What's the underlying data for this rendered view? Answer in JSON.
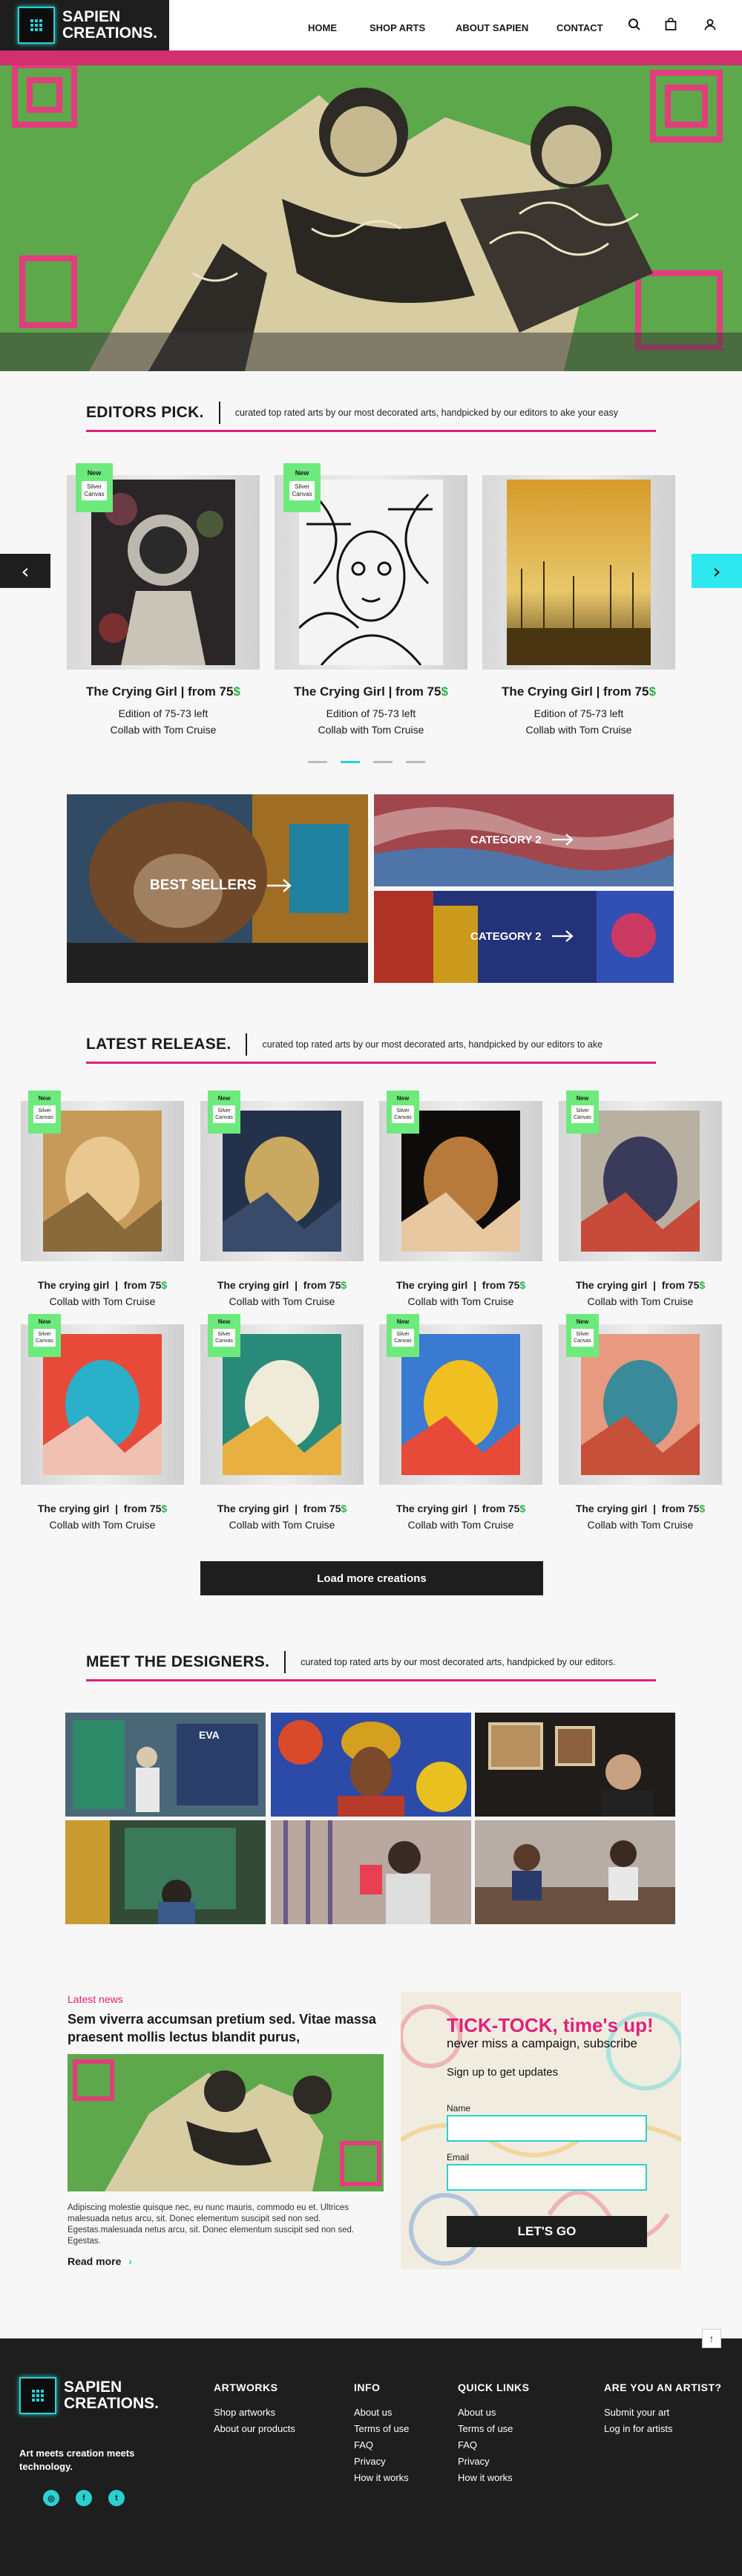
{
  "header": {
    "brand_line1": "SAPIEN",
    "brand_line2": "CREATIONS.",
    "nav": [
      "HOME",
      "SHOP ARTS",
      "ABOUT SAPIEN",
      "CONTACT"
    ],
    "icons": [
      "search-icon",
      "bag-icon",
      "user-icon"
    ]
  },
  "editors": {
    "title": "EDITORS PICK.",
    "subtitle": "curated top rated arts by our most decorated arts, handpicked by our editors to ake your easy",
    "prev_arrow": "‹",
    "next_arrow": "›",
    "cards": [
      {
        "tag": "New",
        "material": "Silver Canvas",
        "name": "The Crying Girl",
        "price_prefix": "from 75",
        "currency": "$",
        "edition": "Edition of 75-73 left",
        "collab": "Collab with Tom Cruise"
      },
      {
        "tag": "New",
        "material": "Silver Canvas",
        "name": "The Crying Girl",
        "price_prefix": "from 75",
        "currency": "$",
        "edition": "Edition of 75-73 left",
        "collab": "Collab with Tom Cruise"
      },
      {
        "tag": "",
        "material": "",
        "name": "The Crying Girl",
        "price_prefix": "from 75",
        "currency": "$",
        "edition": "Edition of 75-73 left",
        "collab": "Collab with Tom Cruise"
      }
    ],
    "active_dot": 1
  },
  "categories": {
    "best_sellers": "BEST  SELLERS",
    "cat_a": "CATEGORY 2",
    "cat_b": "CATEGORY 2"
  },
  "latest": {
    "title": "LATEST RELEASE.",
    "subtitle": "curated top rated arts by our most decorated arts, handpicked by our editors to ake",
    "tag": "New",
    "material": "Silver Canvas",
    "items": [
      {
        "name": "The crying girl",
        "price": "from 75",
        "currency": "$",
        "collab": "Collab with Tom Cruise"
      },
      {
        "name": "The crying girl",
        "price": "from 75",
        "currency": "$",
        "collab": "Collab with Tom Cruise"
      },
      {
        "name": "The crying girl",
        "price": "from 75",
        "currency": "$",
        "collab": "Collab with Tom Cruise"
      },
      {
        "name": "The crying girl",
        "price": "from 75",
        "currency": "$",
        "collab": "Collab with Tom Cruise"
      },
      {
        "name": "The crying girl",
        "price": "from 75",
        "currency": "$",
        "collab": "Collab with Tom Cruise"
      },
      {
        "name": "The crying girl",
        "price": "from 75",
        "currency": "$",
        "collab": "Collab with Tom Cruise"
      },
      {
        "name": "The crying girl",
        "price": "from 75",
        "currency": "$",
        "collab": "Collab with Tom Cruise"
      },
      {
        "name": "The crying girl",
        "price": "from 75",
        "currency": "$",
        "collab": "Collab with Tom Cruise"
      }
    ],
    "load_more": "Load more creations"
  },
  "designers": {
    "title": "MEET THE DESIGNERS.",
    "subtitle": "curated top rated arts by our most decorated arts, handpicked by our editors.",
    "gallery_label": "EVA"
  },
  "news": {
    "tag": "Latest news",
    "title": "Sem viverra accumsan pretium sed. Vitae massa praesent mollis lectus blandit purus,",
    "body": "Adipiscing molestie quisque nec, eu nunc mauris, commodo eu et. Ultrices malesuada netus arcu, sit. Donec elementum suscipit sed non sed. Egestas.malesuada netus arcu, sit. Donec elementum suscipit sed non sed. Egestas.",
    "read_more": "Read more"
  },
  "subscribe": {
    "headline": "TICK-TOCK, time's up!",
    "tagline": "never miss a campaign, subscribe",
    "signup": "Sign up to get updates",
    "name_label": "Name",
    "email_label": "Email",
    "button": "LET'S GO"
  },
  "footer": {
    "brand_line1": "SAPIEN",
    "brand_line2": "CREATIONS.",
    "tagline": "Art meets creation meets technology.",
    "scroll_top": "↑",
    "columns": [
      {
        "title": "ARTWORKS",
        "links": [
          "Shop artworks",
          "About our products"
        ]
      },
      {
        "title": "INFO",
        "links": [
          "About us",
          "Terms of use",
          "FAQ",
          "Privacy",
          "How it works"
        ]
      },
      {
        "title": "QUICK LINKS",
        "links": [
          "About us",
          "Terms of use",
          "FAQ",
          "Privacy",
          "How it works"
        ]
      },
      {
        "title": "ARE YOU AN ARTIST?",
        "links": [
          "Submit your art",
          "Log in for artists"
        ]
      }
    ],
    "social": [
      "instagram-icon",
      "facebook-icon",
      "twitter-icon"
    ]
  },
  "colors": {
    "accent": "#2ad1d1",
    "pink": "#e0207a",
    "new_tag": "#6dea7c",
    "price_green": "#2db34a",
    "dark": "#1e1e1e"
  }
}
